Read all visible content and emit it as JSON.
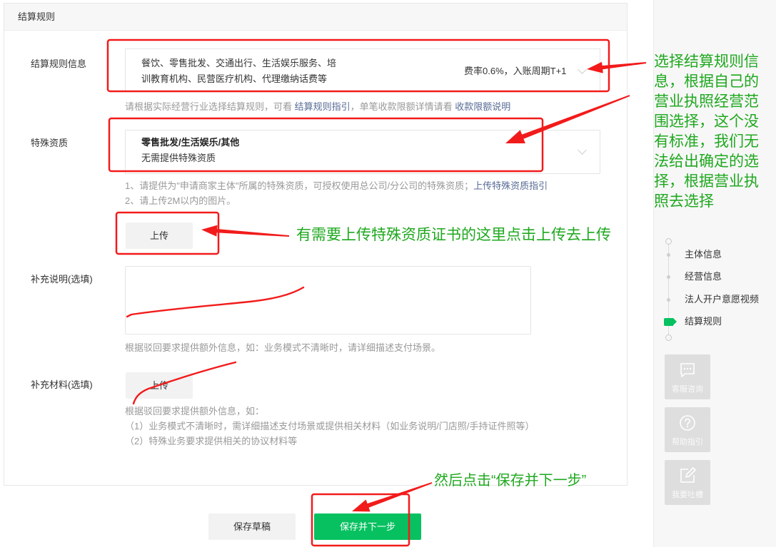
{
  "section": {
    "title": "结算规则"
  },
  "settlement_rule": {
    "label": "结算规则信息",
    "selected_line1": "餐饮、零售批发、交通出行、生活娱乐服务、培",
    "selected_line2": "训教育机构、民营医疗机构、代理缴纳话费等",
    "rate": "费率0.6%，入账周期T+1",
    "help_prefix": "请根据实际经营行业选择结算规则，可看 ",
    "help_link1": "结算规则指引",
    "help_mid": "，单笔收款限额详情请看 ",
    "help_link2": "收款限额说明"
  },
  "special_qualification": {
    "label": "特殊资质",
    "selected_title": "零售批发/生活娱乐/其他",
    "selected_subtitle": "无需提供特殊资质",
    "help1_prefix": "1、请提供为\"申请商家主体\"所属的特殊资质，可授权使用总公司/分公司的特殊资质；",
    "help1_link": "上传特殊资质指引",
    "help2": "2、请上传2M以内的图片。",
    "upload_label": "上传"
  },
  "supplement_description": {
    "label": "补充说明(选填)",
    "help": "根据驳回要求提供额外信息，如：业务模式不清晰时，请详细描述支付场景。"
  },
  "supplement_material": {
    "label": "补充材料(选填)",
    "upload_label": "上传",
    "help_lines": [
      "根据驳回要求提供额外信息，如：",
      "（1）业务模式不清晰时，需详细描述支付场景或提供相关材料（如业务说明/门店照/手持证件照等）",
      "（2）特殊业务要求提供相关的协议材料等"
    ]
  },
  "actions": {
    "save_draft": "保存草稿",
    "save_next": "保存并下一步"
  },
  "steps": [
    {
      "label": "主体信息"
    },
    {
      "label": "经营信息"
    },
    {
      "label": "法人开户意愿视频"
    },
    {
      "label": "结算规则",
      "active": true
    }
  ],
  "side_tools": [
    {
      "label": "客服咨询",
      "icon": "chat-icon"
    },
    {
      "label": "帮助指引",
      "icon": "question-icon"
    },
    {
      "label": "我要吐槽",
      "icon": "edit-icon"
    }
  ],
  "annotations": {
    "rule_tip_lines": [
      "选择结算规则信",
      "息，根据自己的",
      "营业执照经营范",
      "围选择，这个没",
      "有标准，我们无",
      "法给出确定的选",
      "择，根据营业执",
      "照去选择"
    ],
    "upload_tip": "有需要上传特殊资质证书的这里点击上传去上传",
    "next_tip": "然后点击“保存并下一步”"
  },
  "colors": {
    "primary": "#07c160",
    "link": "#576b95",
    "annotation_red": "#f21b1b",
    "annotation_green": "#1fa81f"
  }
}
